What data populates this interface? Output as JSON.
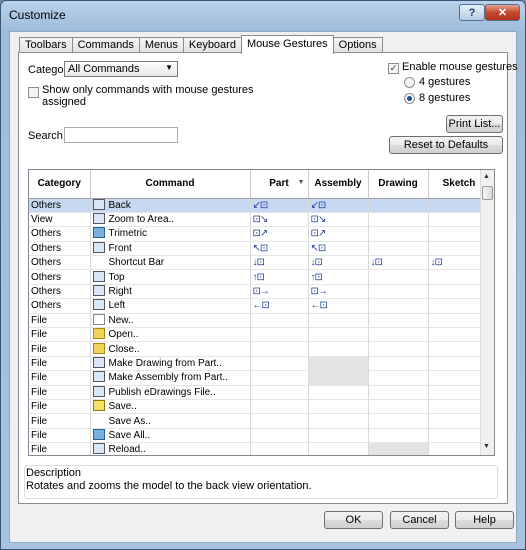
{
  "window": {
    "title": "Customize",
    "help_glyph": "?",
    "close_glyph": "✕"
  },
  "tabs": [
    {
      "label": "Toolbars"
    },
    {
      "label": "Commands"
    },
    {
      "label": "Menus"
    },
    {
      "label": "Keyboard"
    },
    {
      "label": "Mouse Gestures"
    },
    {
      "label": "Options"
    }
  ],
  "active_tab": "Mouse Gestures",
  "filters": {
    "category_label": "Category:",
    "category_value": "All Commands",
    "show_only_label_line1": "Show only commands with mouse gestures",
    "show_only_label_line2": "assigned",
    "search_label": "Search for:",
    "search_value": ""
  },
  "gestures": {
    "enable_label": "Enable mouse gestures",
    "enable_checked": true,
    "option_4": "4 gestures",
    "option_8": "8 gestures",
    "selected": "8 gestures"
  },
  "buttons": {
    "print_list": "Print List...",
    "reset": "Reset to Defaults",
    "ok": "OK",
    "cancel": "Cancel",
    "help": "Help"
  },
  "table": {
    "columns": [
      "Category",
      "Command",
      "Part",
      "Assembly",
      "Drawing",
      "Sketch"
    ],
    "rows": [
      {
        "category": "Others",
        "command": "Back",
        "icon": "back-view-icon",
        "part": "↙⊡",
        "assembly": "↙⊡",
        "drawing": "",
        "sketch": "",
        "selected": true
      },
      {
        "category": "View",
        "command": "Zoom to Area..",
        "icon": "zoom-area-icon",
        "part": "⊡↘",
        "assembly": "⊡↘",
        "drawing": "",
        "sketch": ""
      },
      {
        "category": "Others",
        "command": "Trimetric",
        "icon": "trimetric-view-icon",
        "part": "⊡↗",
        "assembly": "⊡↗",
        "drawing": "",
        "sketch": ""
      },
      {
        "category": "Others",
        "command": "Front",
        "icon": "front-view-icon",
        "part": "↖⊡",
        "assembly": "↖⊡",
        "drawing": "",
        "sketch": ""
      },
      {
        "category": "Others",
        "command": "Shortcut Bar",
        "icon": "",
        "part": "↓⊡",
        "assembly": "↓⊡",
        "drawing": "↓⊡",
        "sketch": "↓⊡"
      },
      {
        "category": "Others",
        "command": "Top",
        "icon": "top-view-icon",
        "part": "↑⊡",
        "assembly": "↑⊡",
        "drawing": "",
        "sketch": ""
      },
      {
        "category": "Others",
        "command": "Right",
        "icon": "right-view-icon",
        "part": "⊡→",
        "assembly": "⊡→",
        "drawing": "",
        "sketch": ""
      },
      {
        "category": "Others",
        "command": "Left",
        "icon": "left-view-icon",
        "part": "←⊡",
        "assembly": "←⊡",
        "drawing": "",
        "sketch": ""
      },
      {
        "category": "File",
        "command": "New..",
        "icon": "new-document-icon",
        "part": "",
        "assembly": "",
        "drawing": "",
        "sketch": ""
      },
      {
        "category": "File",
        "command": "Open..",
        "icon": "open-folder-icon",
        "part": "",
        "assembly": "",
        "drawing": "",
        "sketch": ""
      },
      {
        "category": "File",
        "command": "Close..",
        "icon": "close-folder-icon",
        "part": "",
        "assembly": "",
        "drawing": "",
        "sketch": ""
      },
      {
        "category": "File",
        "command": "Make Drawing from Part..",
        "icon": "make-drawing-icon",
        "part": "",
        "assembly": "",
        "drawing": "",
        "sketch": "",
        "gray_assembly": true
      },
      {
        "category": "File",
        "command": "Make Assembly from Part..",
        "icon": "make-assembly-icon",
        "part": "",
        "assembly": "",
        "drawing": "",
        "sketch": "",
        "gray_assembly": true
      },
      {
        "category": "File",
        "command": "Publish eDrawings File..",
        "icon": "edrawings-icon",
        "part": "",
        "assembly": "",
        "drawing": "",
        "sketch": ""
      },
      {
        "category": "File",
        "command": "Save..",
        "icon": "save-icon",
        "part": "",
        "assembly": "",
        "drawing": "",
        "sketch": ""
      },
      {
        "category": "File",
        "command": "Save As..",
        "icon": "",
        "part": "",
        "assembly": "",
        "drawing": "",
        "sketch": ""
      },
      {
        "category": "File",
        "command": "Save All..",
        "icon": "save-all-icon",
        "part": "",
        "assembly": "",
        "drawing": "",
        "sketch": ""
      },
      {
        "category": "File",
        "command": "Reload..",
        "icon": "reload-icon",
        "part": "",
        "assembly": "",
        "drawing": "",
        "sketch": "",
        "gray_drawing": true
      }
    ]
  },
  "description": {
    "label": "Description",
    "text": "Rotates and zooms the model to the back view orientation."
  }
}
